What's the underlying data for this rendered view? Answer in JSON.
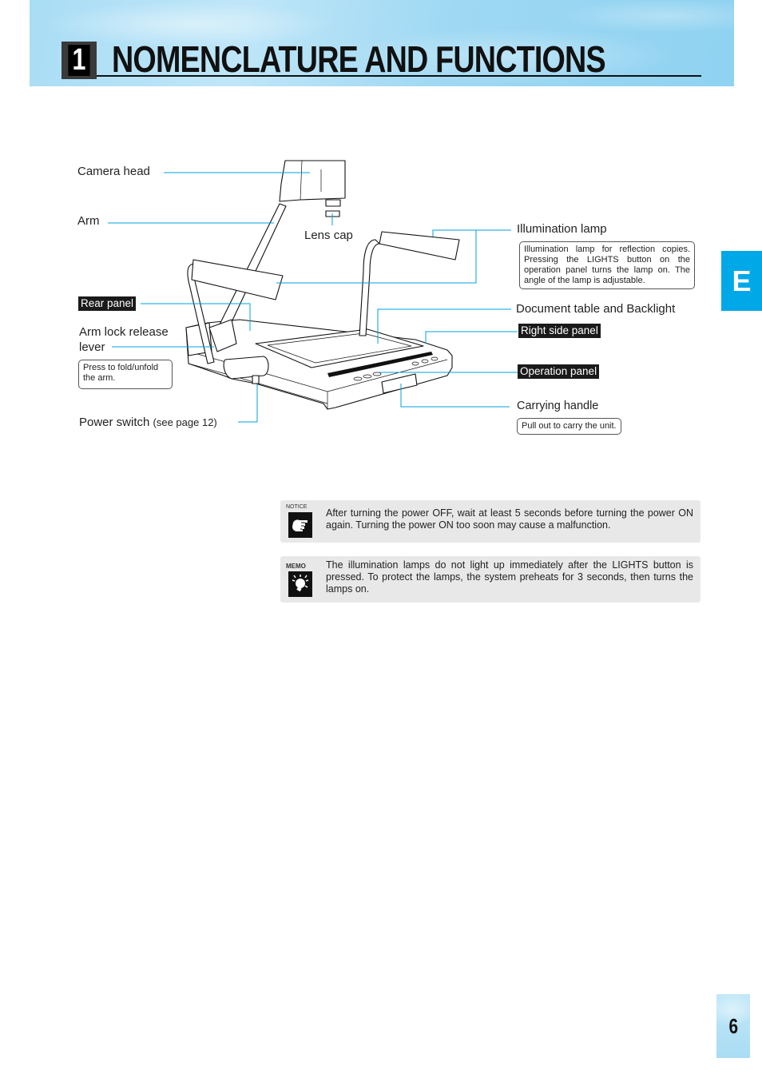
{
  "header": {
    "chapter_number": "1",
    "title": "NOMENCLATURE AND FUNCTIONS"
  },
  "side_tab": {
    "language_letter": "E"
  },
  "page_number": "6",
  "diagram": {
    "labels": {
      "camera_head": "Camera head",
      "arm": "Arm",
      "lens_cap": "Lens cap",
      "illumination_lamp": "Illumination lamp",
      "rear_panel": "Rear panel",
      "arm_lock_release_lever_line1": "Arm lock release",
      "arm_lock_release_lever_line2": "lever",
      "document_table": "Document table and Backlight",
      "right_side_panel": "Right side panel",
      "operation_panel": "Operation panel",
      "carrying_handle": "Carrying handle",
      "power_switch": "Power switch",
      "power_switch_ref": "(see page 12)"
    },
    "notes": {
      "illumination_lamp": "Illumination lamp for reflection copies. Pressing the LIGHTS button on the operation panel turns the lamp on. The angle of the lamp is adjustable.",
      "arm_lock": "Press to fold/unfold the arm.",
      "carrying_handle": "Pull out to carry the unit."
    },
    "leader_color": "#00a0dc"
  },
  "callouts": {
    "notice": {
      "icon_label": "NOTICE",
      "icon": "pointing-hand-icon",
      "text": "After turning the power OFF, wait at least 5 seconds before turning the power ON again. Turning the power ON too soon may cause a malfunction."
    },
    "memo": {
      "icon_label": "MEMO",
      "icon": "lightbulb-icon",
      "text": "The illumination lamps do not light up immediately after the LIGHTS button is pressed. To protect the lamps, the system preheats for 3 seconds, then turns the lamps on."
    }
  },
  "colors": {
    "accent_blue": "#00a8e8",
    "header_sky": "#a9ddf5",
    "callout_bg": "#e8e8e8"
  }
}
